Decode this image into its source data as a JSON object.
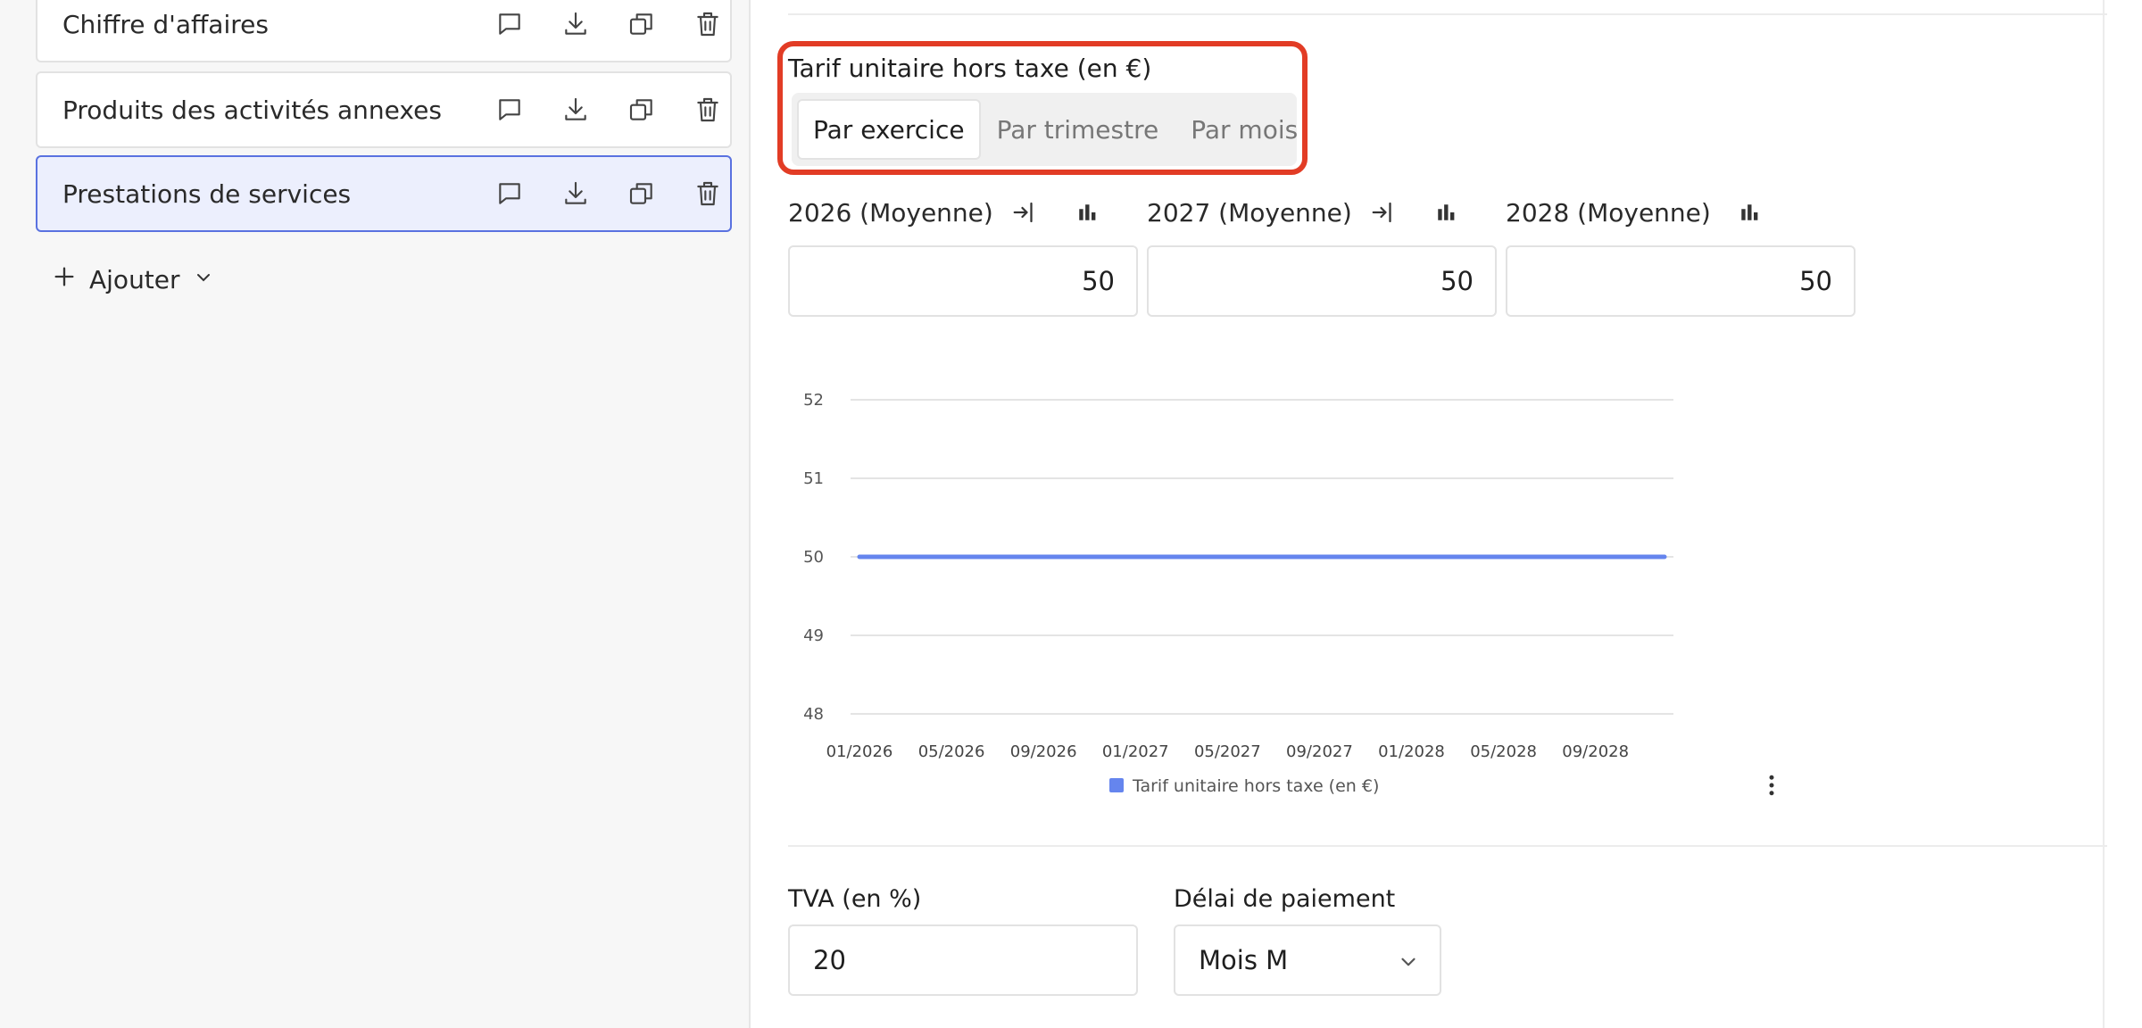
{
  "sidebar": {
    "items": [
      {
        "label": "Chiffre d'affaires"
      },
      {
        "label": "Produits des activités annexes"
      },
      {
        "label": "Prestations de services"
      }
    ],
    "add_label": "Ajouter"
  },
  "field": {
    "title": "Tarif unitaire hors taxe (en €)",
    "tabs": [
      "Par exercice",
      "Par trimestre",
      "Par mois"
    ],
    "selected_tab": "Par exercice"
  },
  "years": [
    {
      "label": "2026 (Moyenne)",
      "value": "50"
    },
    {
      "label": "2027 (Moyenne)",
      "value": "50"
    },
    {
      "label": "2028 (Moyenne)",
      "value": "50"
    }
  ],
  "chart_data": {
    "type": "line",
    "x_tick_labels": [
      "01/2026",
      "05/2026",
      "09/2026",
      "01/2027",
      "05/2027",
      "09/2027",
      "01/2028",
      "05/2028",
      "09/2028"
    ],
    "ylim": [
      48,
      52
    ],
    "y_ticks": [
      48,
      49,
      50,
      51,
      52
    ],
    "grid": true,
    "legend_position": "bottom",
    "series": [
      {
        "name": "Tarif unitaire hors taxe (en €)",
        "color": "#6585ee",
        "x": [
          "01/2026",
          "02/2026",
          "03/2026",
          "04/2026",
          "05/2026",
          "06/2026",
          "07/2026",
          "08/2026",
          "09/2026",
          "10/2026",
          "11/2026",
          "12/2026",
          "01/2027",
          "02/2027",
          "03/2027",
          "04/2027",
          "05/2027",
          "06/2027",
          "07/2027",
          "08/2027",
          "09/2027",
          "10/2027",
          "11/2027",
          "12/2027",
          "01/2028",
          "02/2028",
          "03/2028",
          "04/2028",
          "05/2028",
          "06/2028",
          "07/2028",
          "08/2028",
          "09/2028",
          "10/2028",
          "11/2028",
          "12/2028"
        ],
        "values": [
          50,
          50,
          50,
          50,
          50,
          50,
          50,
          50,
          50,
          50,
          50,
          50,
          50,
          50,
          50,
          50,
          50,
          50,
          50,
          50,
          50,
          50,
          50,
          50,
          50,
          50,
          50,
          50,
          50,
          50,
          50,
          50,
          50,
          50,
          50,
          50
        ]
      }
    ]
  },
  "form": {
    "tva_label": "TVA (en %)",
    "tva_value": "20",
    "delai_label": "Délai de paiement",
    "delai_value": "Mois M"
  },
  "colors": {
    "accent": "#5a72e0",
    "highlight": "#e23c25",
    "series": "#6585ee"
  }
}
